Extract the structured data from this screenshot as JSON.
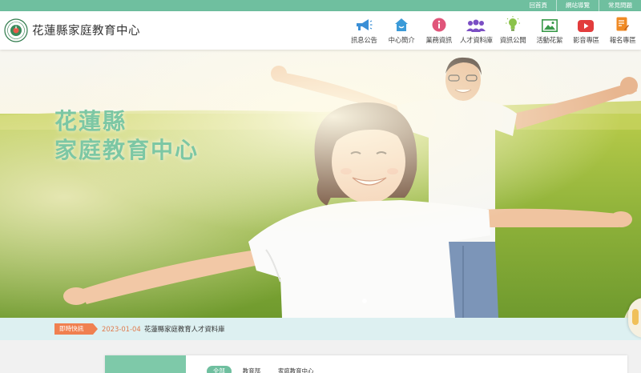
{
  "top_links": [
    "回首頁",
    "網站導覽",
    "常見問題"
  ],
  "site_title": "花蓮縣家庭教育中心",
  "logo_alt": "教育部",
  "nav": [
    {
      "label": "訊息公告",
      "icon": "megaphone-icon",
      "color": "#3b8fd6"
    },
    {
      "label": "中心簡介",
      "icon": "house-icon",
      "color": "#3b9ad8"
    },
    {
      "label": "業務資訊",
      "icon": "info-icon",
      "color": "#e0557a"
    },
    {
      "label": "人才資料庫",
      "icon": "people-icon",
      "color": "#7b4fc4"
    },
    {
      "label": "資訊公開",
      "icon": "lightbulb-icon",
      "color": "#8bc34a"
    },
    {
      "label": "活動花絮",
      "icon": "picture-icon",
      "color": "#3a9a4a"
    },
    {
      "label": "影音專區",
      "icon": "video-icon",
      "color": "#e23c3c"
    },
    {
      "label": "報名專區",
      "icon": "form-icon",
      "color": "#f08a24"
    }
  ],
  "hero": {
    "line1": "花蓮縣",
    "line2": "家庭教育中心"
  },
  "ticker": {
    "badge": "即時快訊",
    "date": "2023-01-04",
    "text": "花蓮縣家庭教育人才資料庫"
  },
  "tabs": [
    "全部",
    "教育部",
    "家庭教育中心"
  ],
  "colors": {
    "brand": "#6fbf9f",
    "title": "#7cc7a4",
    "ticker_bg": "#ddf0f1",
    "badge": "#f08050"
  }
}
